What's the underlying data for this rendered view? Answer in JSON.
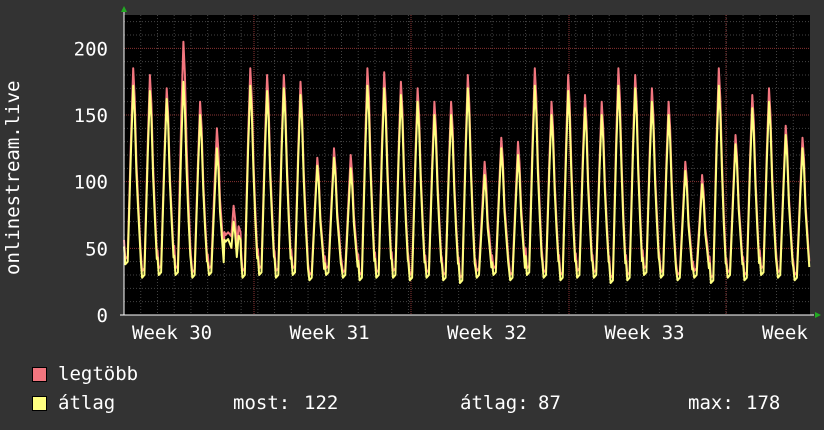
{
  "chart_data": {
    "type": "line",
    "ylabel": "onlinestream.live",
    "ylim": [
      0,
      225
    ],
    "y_ticks": [
      "0",
      "50",
      "100",
      "150",
      "200"
    ],
    "x_tick_labels": [
      "Week 30",
      "Week 31",
      "Week 32",
      "Week 33",
      "Week"
    ],
    "grid": true,
    "background": "#000000",
    "series": [
      {
        "name": "legtöbb",
        "color": "#f2767f",
        "daily_peaks": [
          185,
          180,
          170,
          205,
          160,
          140,
          82,
          185,
          180,
          180,
          175,
          118,
          125,
          120,
          185,
          182,
          175,
          170,
          160,
          160,
          180,
          115,
          133,
          130,
          185,
          160,
          180,
          165,
          160,
          185,
          180,
          170,
          160,
          115,
          105,
          185,
          135,
          165,
          170,
          142,
          133
        ],
        "daily_mins": [
          42,
          33,
          35,
          35,
          32,
          35,
          60,
          33,
          35,
          33,
          35,
          30,
          35,
          32,
          30,
          32,
          33,
          30,
          32,
          30,
          28,
          33,
          35,
          30,
          35,
          32,
          30,
          33,
          32,
          28,
          30,
          35,
          32,
          30,
          33,
          28,
          32,
          30,
          35,
          32,
          30
        ]
      },
      {
        "name": "átlag",
        "color": "#ffff80",
        "daily_peaks": [
          172,
          168,
          162,
          175,
          150,
          125,
          70,
          172,
          168,
          170,
          165,
          112,
          118,
          110,
          172,
          170,
          165,
          160,
          150,
          150,
          170,
          105,
          125,
          120,
          172,
          150,
          168,
          155,
          150,
          172,
          170,
          160,
          150,
          108,
          98,
          172,
          128,
          155,
          160,
          135,
          125
        ],
        "daily_mins": [
          38,
          28,
          30,
          30,
          28,
          30,
          55,
          28,
          30,
          28,
          30,
          26,
          30,
          28,
          26,
          28,
          28,
          26,
          28,
          26,
          24,
          28,
          30,
          26,
          30,
          28,
          26,
          28,
          28,
          24,
          26,
          30,
          28,
          26,
          28,
          24,
          28,
          26,
          30,
          28,
          26
        ]
      }
    ],
    "stats": {
      "most_label": "most:",
      "most_value": "122",
      "atlag_label": "átlag:",
      "atlag_value": "87",
      "max_label": "max:",
      "max_value": "178"
    }
  }
}
